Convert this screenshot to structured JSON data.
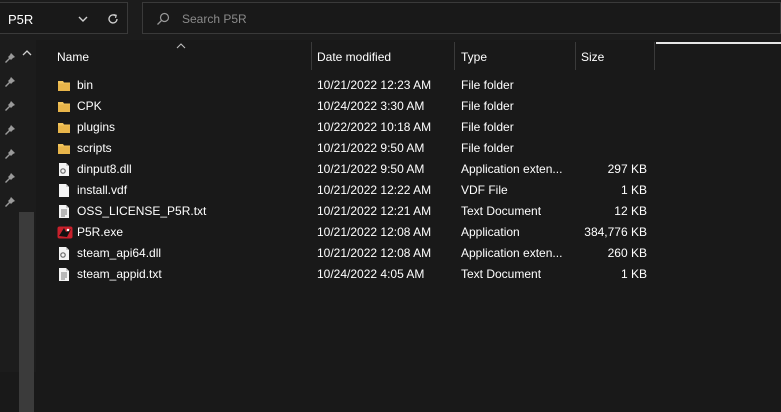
{
  "address": {
    "path": "P5R"
  },
  "search": {
    "placeholder": "Search P5R"
  },
  "columns": {
    "name": "Name",
    "date": "Date modified",
    "type": "Type",
    "size": "Size"
  },
  "colors": {
    "background": "#191919",
    "folder": "#f2c55c",
    "text": "#ffffff",
    "muted": "#8a8a8a"
  },
  "files": [
    {
      "icon": "folder-icon",
      "name": "bin",
      "date": "10/21/2022 12:23 AM",
      "type": "File folder",
      "size": ""
    },
    {
      "icon": "folder-icon",
      "name": "CPK",
      "date": "10/24/2022 3:30 AM",
      "type": "File folder",
      "size": ""
    },
    {
      "icon": "folder-icon",
      "name": "plugins",
      "date": "10/22/2022 10:18 AM",
      "type": "File folder",
      "size": ""
    },
    {
      "icon": "folder-icon",
      "name": "scripts",
      "date": "10/21/2022 9:50 AM",
      "type": "File folder",
      "size": ""
    },
    {
      "icon": "dll-file-icon",
      "name": "dinput8.dll",
      "date": "10/21/2022 9:50 AM",
      "type": "Application exten...",
      "size": "297 KB"
    },
    {
      "icon": "file-icon",
      "name": "install.vdf",
      "date": "10/21/2022 12:22 AM",
      "type": "VDF File",
      "size": "1 KB"
    },
    {
      "icon": "text-file-icon",
      "name": "OSS_LICENSE_P5R.txt",
      "date": "10/21/2022 12:21 AM",
      "type": "Text Document",
      "size": "12 KB"
    },
    {
      "icon": "exe-app-icon",
      "name": "P5R.exe",
      "date": "10/21/2022 12:08 AM",
      "type": "Application",
      "size": "384,776 KB"
    },
    {
      "icon": "dll-file-icon",
      "name": "steam_api64.dll",
      "date": "10/21/2022 12:08 AM",
      "type": "Application exten...",
      "size": "260 KB"
    },
    {
      "icon": "text-file-icon",
      "name": "steam_appid.txt",
      "date": "10/24/2022 4:05 AM",
      "type": "Text Document",
      "size": "1 KB"
    }
  ]
}
